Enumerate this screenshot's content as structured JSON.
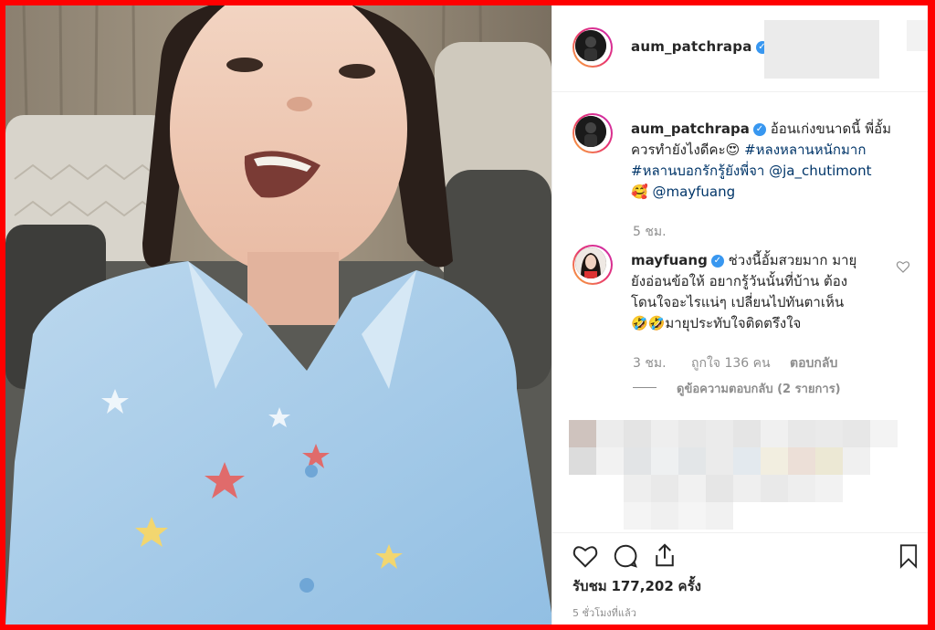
{
  "post": {
    "author": "aum_patchrapa",
    "caption": {
      "username": "aum_patchrapa",
      "text": "อ้อนเก่งขนาดนี้ พี่อั้มควรทำยังไงดีคะ😍 #หลงหลานหนักมาก #หลานบอกรักรู้ยังพี่จา @ja_chutimont 🥰 @mayfuang",
      "line1": "อ้อนเก่งขนาดนี้ พี่อั้ม",
      "line2_text": "ควรทำยังไงดีคะ",
      "line2_hashtag": "#หลงหลานหนักมาก",
      "line3_hashtag": "#หลานบอกรักรู้ยังพี่จา",
      "line3_mention": "@ja_chutimont",
      "line4_mention": "@mayfuang",
      "time": "5 ชม."
    },
    "comment": {
      "username": "mayfuang",
      "line1": "ช่วงนี้อั้มสวยมาก มายุ",
      "line2": "ยังอ่อนข้อให้ อยากรู้วันนั้นที่บ้าน ต้อง",
      "line3": "โดนใจอะไรแน่ๆ เปลี่ยนไปทันตาเห็น",
      "line4": "มายุประทับใจติดตรึงใจ",
      "emoji_line4": "🤣🤣",
      "time": "3 ชม.",
      "likes": "ถูกใจ 136 คน",
      "reply": "ตอบกลับ",
      "view_replies": "ดูข้อความตอบกลับ (2 รายการ)"
    },
    "views_label": "รับชม",
    "views_count": "177,202",
    "views_unit": "ครั้ง",
    "time_ago": "5 ชั่วโมงที่แล้ว"
  },
  "icons": [
    "heart-icon",
    "comment-icon",
    "share-icon",
    "bookmark-icon",
    "verified-icon",
    "heart-small-icon"
  ],
  "colors": {
    "frame": "#ff0000",
    "hashtag": "#003569",
    "verified": "#3897f0",
    "meta": "#8e8e8e"
  }
}
